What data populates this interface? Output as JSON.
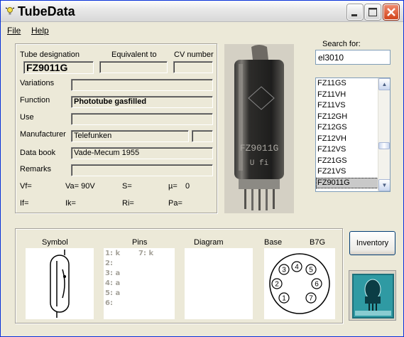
{
  "window": {
    "title": "TubeData"
  },
  "menu": {
    "file": "File",
    "help": "Help"
  },
  "tube": {
    "designation_label": "Tube designation",
    "designation": "FZ9011G",
    "equivalent_label": "Equivalent to",
    "equivalent": "",
    "cv_label": "CV number",
    "cv": "",
    "variations_label": "Variations",
    "variations": "",
    "function_label": "Function",
    "function": "Phototube gasfilled",
    "use_label": "Use",
    "use": "",
    "manufacturer_label": "Manufacturer",
    "manufacturer": "Telefunken",
    "manufacturer_extra": "",
    "databook_label": "Data book",
    "databook": "Vade-Mecum 1955",
    "remarks_label": "Remarks",
    "remarks": ""
  },
  "params": {
    "vf": "Vf=",
    "va": "Va= 90V",
    "s": "S=",
    "mu_label": "µ=",
    "mu_value": "0",
    "if": "If=",
    "ik": "Ik=",
    "ri": "Ri=",
    "pa": "Pa="
  },
  "photo": {
    "text_line1": "FZ9011G",
    "text_line2": "U fi"
  },
  "search": {
    "label": "Search for:",
    "value": "el3010",
    "results": [
      "FZ11GS",
      "FZ11VH",
      "FZ11VS",
      "FZ12GH",
      "FZ12GS",
      "FZ12VH",
      "FZ12VS",
      "FZ21GS",
      "FZ21VS",
      "FZ9011G"
    ],
    "selected": "FZ9011G"
  },
  "bottom": {
    "symbol_label": "Symbol",
    "pins_label": "Pins",
    "diagram_label": "Diagram",
    "base_label": "Base",
    "base_type": "B7G",
    "pins": [
      "1: k",
      "7: k",
      "2:",
      "3: a",
      "4: a",
      "5: a",
      "6:"
    ],
    "base_pin_numbers": [
      "1",
      "2",
      "3",
      "4",
      "5",
      "6",
      "7"
    ]
  },
  "buttons": {
    "inventory": "Inventory"
  },
  "colors": {
    "title_bar": "#e9e9e9",
    "face": "#ece9d8",
    "close_button": "#d1441b",
    "selection": "#c9c9c9"
  },
  "icons": [
    "lightbulb-icon",
    "minimize-icon",
    "maximize-icon",
    "close-icon",
    "scroll-up-icon",
    "scroll-down-icon",
    "tube-logo-icon"
  ]
}
